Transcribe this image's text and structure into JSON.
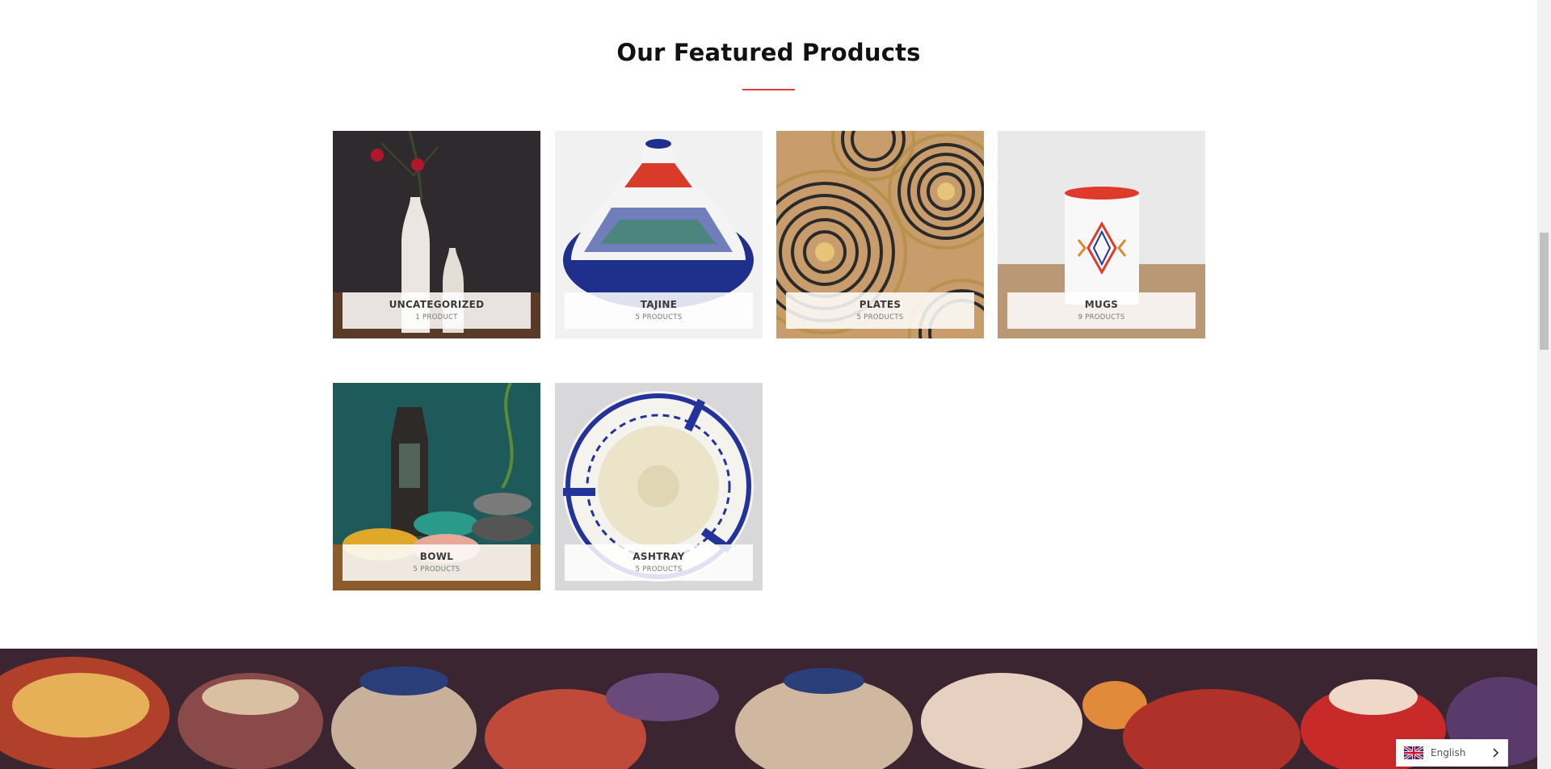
{
  "section": {
    "title": "Our Featured Products"
  },
  "categories": [
    {
      "name": "UNCATEGORIZED",
      "count": "1 PRODUCT"
    },
    {
      "name": "TAJINE",
      "count": "5 PRODUCTS"
    },
    {
      "name": "PLATES",
      "count": "5 PRODUCTS"
    },
    {
      "name": "MUGS",
      "count": "9 PRODUCTS"
    },
    {
      "name": "BOWL",
      "count": "5 PRODUCTS"
    },
    {
      "name": "ASHTRAY",
      "count": "5 PRODUCTS"
    }
  ],
  "language": {
    "current": "English"
  },
  "colors": {
    "accent": "#e03a3a",
    "title": "#111111"
  }
}
